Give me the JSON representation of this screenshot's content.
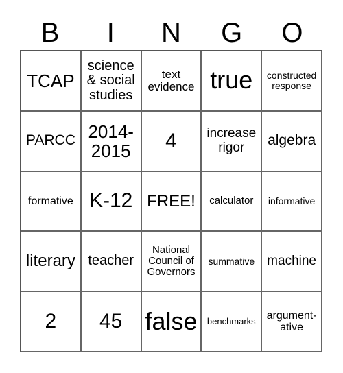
{
  "header": [
    "B",
    "I",
    "N",
    "G",
    "O"
  ],
  "cells": [
    [
      "TCAP",
      "science & social studies",
      "text evidence",
      "true",
      "constructed response"
    ],
    [
      "PARCC",
      "2014-2015",
      "4",
      "increase rigor",
      "algebra"
    ],
    [
      "formative",
      "K-12",
      "FREE!",
      "calculator",
      "informative"
    ],
    [
      "literary",
      "teacher",
      "National Council of Governors",
      "summative",
      "machine"
    ],
    [
      "2",
      "45",
      "false",
      "benchmarks",
      "argument-ative"
    ]
  ]
}
